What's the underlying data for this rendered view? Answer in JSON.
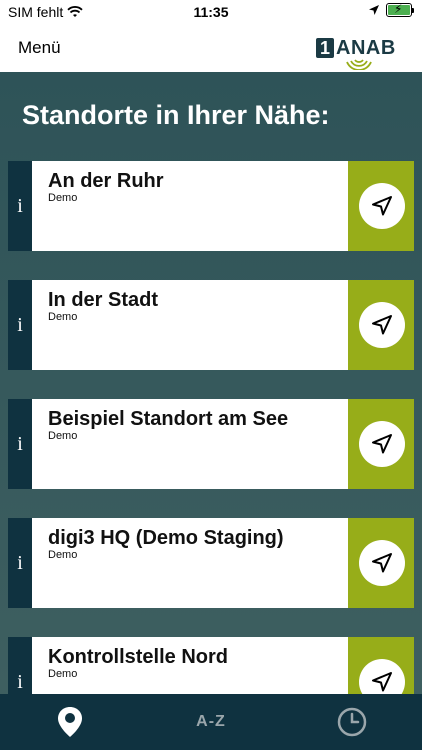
{
  "status_bar": {
    "carrier": "SIM fehlt",
    "time": "11:35"
  },
  "navbar": {
    "menu_label": "Menü",
    "logo_number": "1",
    "logo_text": "ANAB"
  },
  "heading": "Standorte in Ihrer Nähe:",
  "locations": [
    {
      "name": "An der Ruhr",
      "subtitle": "Demo"
    },
    {
      "name": "In der Stadt",
      "subtitle": "Demo"
    },
    {
      "name": "Beispiel Standort am See",
      "subtitle": "Demo"
    },
    {
      "name": "digi3 HQ (Demo Staging)",
      "subtitle": "Demo"
    },
    {
      "name": "Kontrollstelle Nord",
      "subtitle": "Demo"
    }
  ],
  "info_glyph": "i",
  "tabs": [
    {
      "icon": "map-pin-icon",
      "active": true
    },
    {
      "label": "A-Z",
      "active": false
    },
    {
      "icon": "clock-icon",
      "active": false
    }
  ],
  "colors": {
    "header_green": "#2e5358",
    "accent_green": "#97ad19",
    "dark_teal": "#0f3240"
  }
}
